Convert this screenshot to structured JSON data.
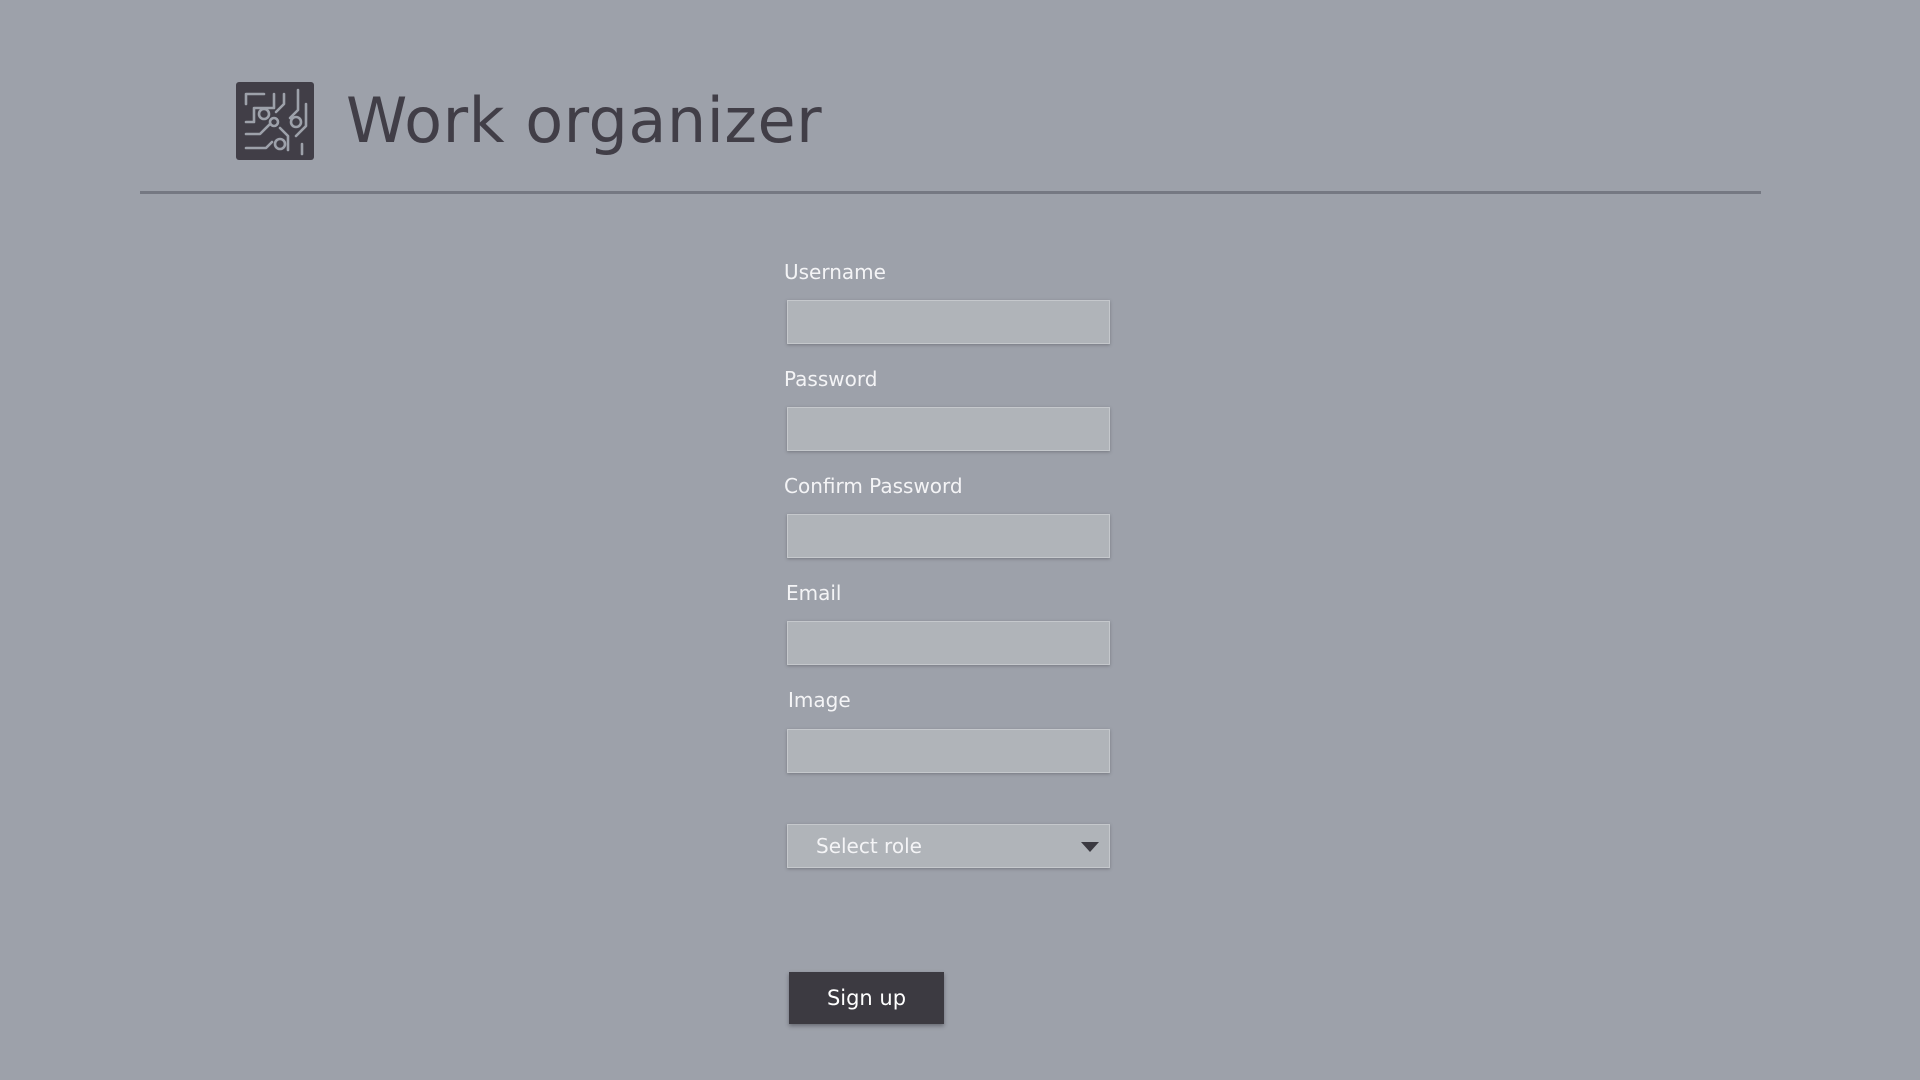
{
  "header": {
    "app_title": "Work organizer",
    "logo_icon": "circuit-board-icon"
  },
  "form": {
    "fields": [
      {
        "label": "Username",
        "value": "",
        "placeholder": ""
      },
      {
        "label": "Password",
        "value": "",
        "placeholder": ""
      },
      {
        "label": "Confirm Password",
        "value": "",
        "placeholder": ""
      },
      {
        "label": "Email",
        "value": "",
        "placeholder": ""
      },
      {
        "label": "Image",
        "value": "",
        "placeholder": ""
      }
    ],
    "role_select": {
      "selected": "Select role",
      "arrow_icon": "caret-down-icon"
    },
    "submit_label": "Sign up"
  },
  "colors": {
    "background": "#9da1aa",
    "title": "#413e47",
    "input_fill": "#b0b4b9",
    "button": "#3c3a41",
    "label_text": "#f4f4f6"
  }
}
